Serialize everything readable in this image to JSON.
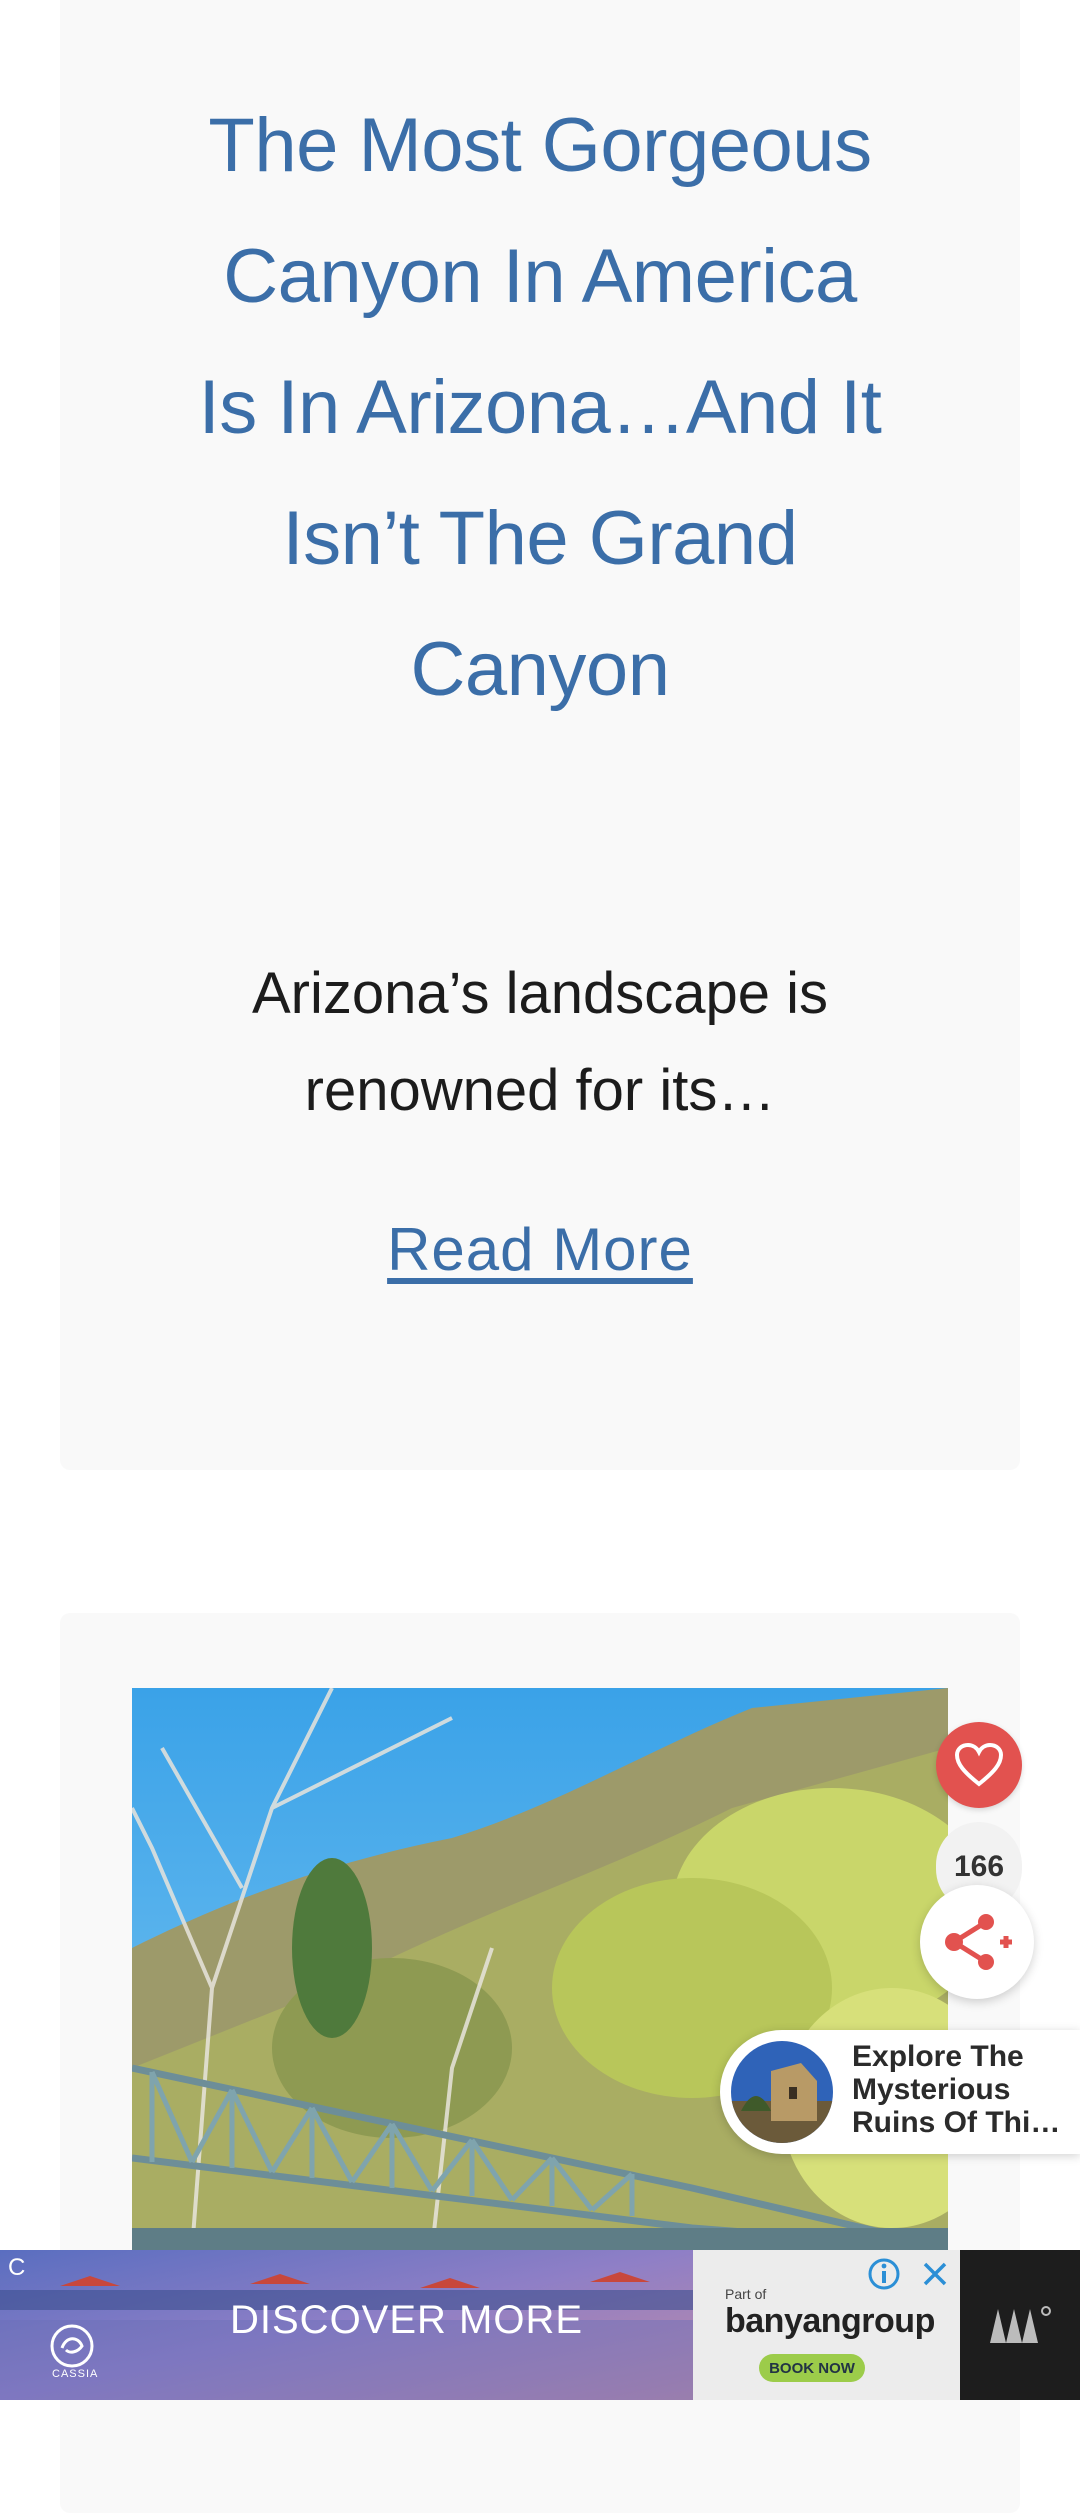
{
  "article1": {
    "title": "The Most Gorgeous Canyon In America Is In Arizona…And It Isn’t The Grand Canyon",
    "excerpt": "Arizona’s landscape is renowned for its…",
    "read_more": "Read More"
  },
  "share": {
    "count": "166",
    "heart_color": "#e2524f"
  },
  "related": {
    "title": "Explore The\nMysterious\nRuins Of Thi…"
  },
  "ad": {
    "cta": "DISCOVER MORE",
    "brand_logo_text": "CASSIA",
    "corner_letter": "C",
    "part_of": "Part of",
    "partner": "banyangroup",
    "book_now": "BOOK NOW"
  },
  "colors": {
    "link": "#3b6ea8",
    "card_bg": "#f9f9f9"
  }
}
